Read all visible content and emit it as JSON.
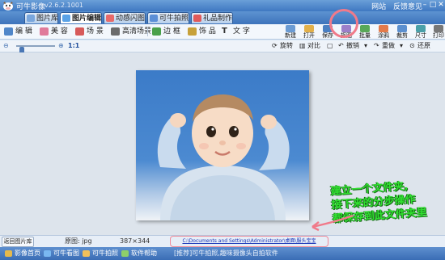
{
  "app": {
    "title": "可牛影像",
    "version": "v2.6.2.1001"
  },
  "top_links": [
    "网站",
    "反馈意见"
  ],
  "window_controls": [
    "–",
    "□",
    "✕"
  ],
  "tabs": [
    {
      "label": "图片库",
      "icon": "image-library-icon",
      "color": "#7aa7dd"
    },
    {
      "label": "图片编辑",
      "icon": "image-edit-icon",
      "color": "#5aa2e6",
      "active": true
    },
    {
      "label": "动感闪图",
      "icon": "flash-image-icon",
      "color": "#e86a6a"
    },
    {
      "label": "可牛拍照",
      "icon": "camera-icon",
      "color": "#5c8fd6"
    },
    {
      "label": "礼品制作",
      "icon": "gift-icon",
      "color": "#e05a5a"
    }
  ],
  "tools": [
    {
      "label": "编 辑",
      "icon": "edit-icon",
      "color": "#4f86c9"
    },
    {
      "label": "美 容",
      "icon": "beauty-icon",
      "color": "#e07a9a"
    },
    {
      "label": "场 景",
      "icon": "scene-icon",
      "color": "#d75a5a"
    },
    {
      "label": "高清场景",
      "icon": "hd-scene-icon",
      "color": "#6b6b6b"
    },
    {
      "label": "边 框",
      "icon": "frame-icon",
      "color": "#4aa04a"
    },
    {
      "label": "饰 品",
      "icon": "accessory-icon",
      "color": "#c7a13a"
    },
    {
      "label": "文 字",
      "icon": "text-icon",
      "glyph": "T"
    }
  ],
  "big_tools": [
    {
      "label": "新建",
      "icon": "new-icon",
      "color": "#6b9bd3"
    },
    {
      "label": "打开",
      "icon": "open-icon",
      "color": "#e2b04a"
    },
    {
      "label": "保存",
      "icon": "save-icon",
      "color": "#4a7fc2"
    },
    {
      "label": "抠图",
      "icon": "cutout-icon",
      "color": "#9b7fc9"
    },
    {
      "label": "批量",
      "icon": "batch-icon",
      "color": "#58a858"
    },
    {
      "label": "涂鸦",
      "icon": "doodle-icon",
      "color": "#e37a4a"
    },
    {
      "label": "裁剪",
      "icon": "crop-icon",
      "color": "#5b8fcf"
    },
    {
      "label": "尺寸",
      "icon": "resize-icon",
      "color": "#4aa0a8"
    },
    {
      "label": "打印",
      "icon": "print-icon",
      "color": "#777777"
    }
  ],
  "view_bar": {
    "zoom_ratio": "1:1",
    "zoom_level": 0.1,
    "rotate": "旋转",
    "compare": "对比",
    "undo": "撤销",
    "redo": "重做",
    "restore": "还原"
  },
  "annotation": {
    "lines": [
      "建立一个文件夹,",
      "接下来的分步操作",
      "都保存到此文件夹里"
    ],
    "color": "#30e030",
    "ring_color": "#f07a8a"
  },
  "status": {
    "back_button": "返回图片库",
    "original_label": "原图: jpg",
    "dimensions": "387×344",
    "path": "C:\\Documents and Settings\\Administrator\\桌面\\服头宝宝"
  },
  "footer": {
    "items": [
      {
        "label": "影像首页",
        "icon": "home-icon",
        "color": "#e6b94c"
      },
      {
        "label": "可牛看图",
        "icon": "viewer-icon",
        "color": "#7ab8f0"
      },
      {
        "label": "可牛拍照",
        "icon": "camera-icon",
        "color": "#f0c05a"
      },
      {
        "label": "软件帮助",
        "icon": "help-icon",
        "color": "#8fd06a"
      }
    ],
    "tip": "[推荐]可牛拍照,趣味摄像头自拍软件"
  }
}
